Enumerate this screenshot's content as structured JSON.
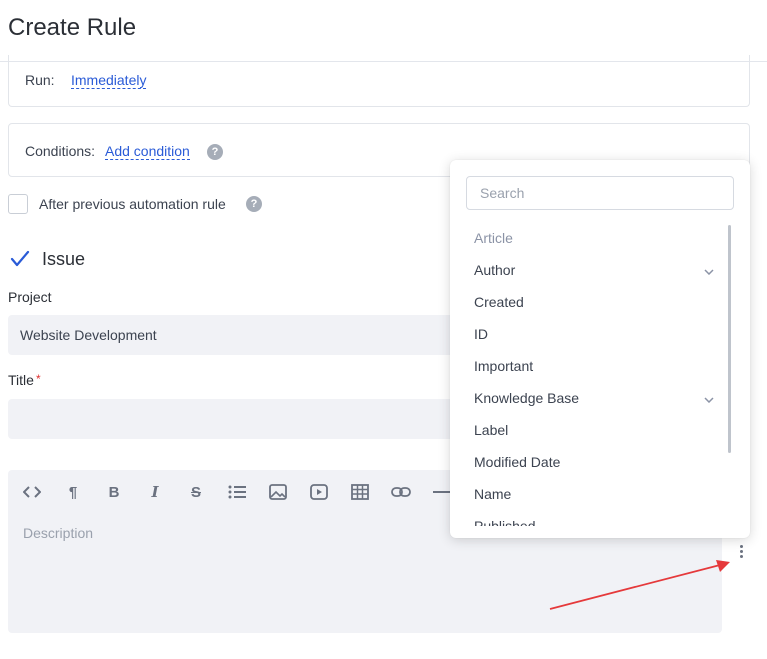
{
  "page": {
    "title": "Create Rule"
  },
  "run": {
    "label": "Run:",
    "value": "Immediately"
  },
  "conditions": {
    "label": "Conditions:",
    "add_label": "Add condition",
    "help": "?"
  },
  "after_previous": {
    "label": "After previous automation rule",
    "checked": false,
    "help": "?"
  },
  "section": {
    "title": "Issue",
    "icon": "check-icon"
  },
  "project": {
    "label": "Project",
    "value": "Website Development"
  },
  "title_field": {
    "label": "Title",
    "required_mark": "*",
    "value": ""
  },
  "editor": {
    "toolbar": [
      "code-icon",
      "paragraph-icon",
      "bold-icon",
      "italic-icon",
      "strikethrough-icon",
      "bullet-list-icon",
      "image-icon",
      "video-icon",
      "table-icon",
      "link-icon",
      "horizontal-rule-icon"
    ],
    "placeholder": "Description"
  },
  "dropdown": {
    "search_placeholder": "Search",
    "group_label": "Article",
    "options": [
      {
        "label": "Author",
        "has_children": true
      },
      {
        "label": "Created",
        "has_children": false
      },
      {
        "label": "ID",
        "has_children": false
      },
      {
        "label": "Important",
        "has_children": false
      },
      {
        "label": "Knowledge Base",
        "has_children": true
      },
      {
        "label": "Label",
        "has_children": false
      },
      {
        "label": "Modified Date",
        "has_children": false
      },
      {
        "label": "Name",
        "has_children": false
      },
      {
        "label": "Published",
        "has_children": false
      }
    ]
  },
  "colors": {
    "accent": "#2a5bd7",
    "annotation_arrow": "#e5393b",
    "required": "#e03131"
  }
}
